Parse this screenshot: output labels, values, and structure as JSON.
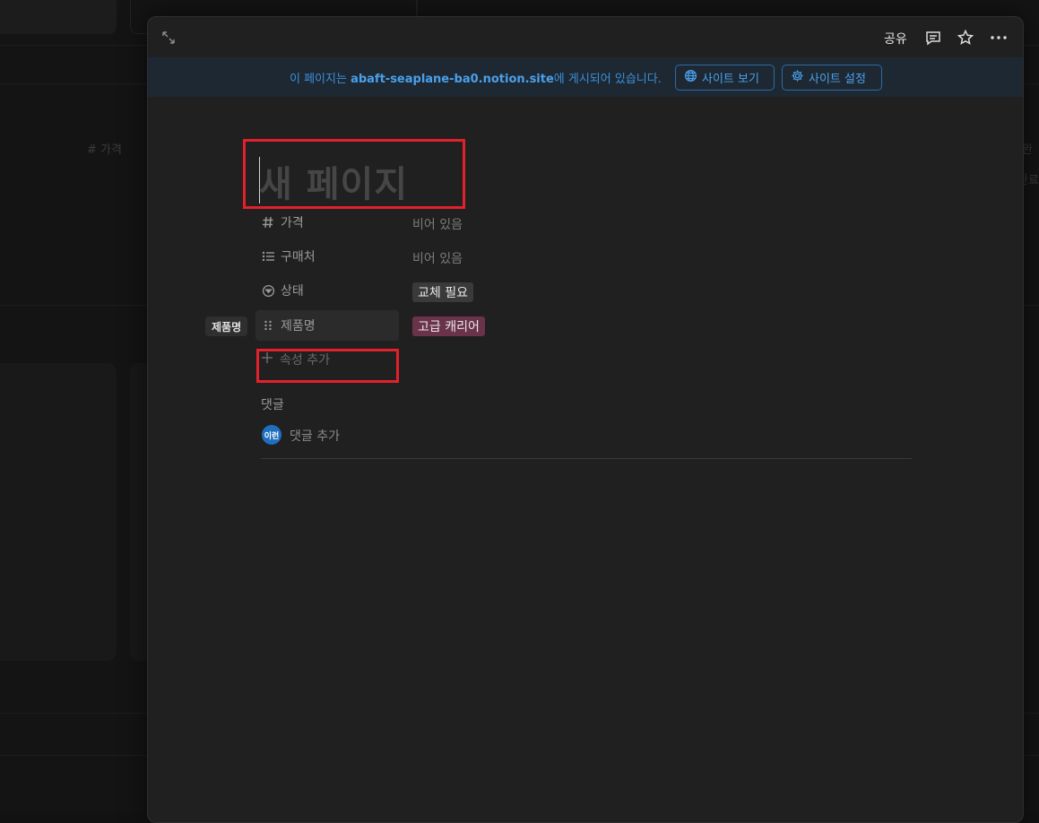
{
  "background": {
    "column_label": "# 가격",
    "right_text_1": "완",
    "right_text_2": "완료"
  },
  "topbar": {
    "expand_icon": "expand-diagonal-icon",
    "share_label": "공유",
    "comment_icon": "comment-icon",
    "star_icon": "star-icon",
    "more_icon": "more-horizontal-icon"
  },
  "banner": {
    "text_prefix": "이 페이지는 ",
    "site_domain": "abaft-seaplane-ba0.notion.site",
    "text_suffix": "에 게시되어 있습니다.",
    "view_site_label": "사이트 보기",
    "site_settings_label": "사이트 설정",
    "accent_color": "#3b8fd9"
  },
  "page": {
    "title_placeholder": "새 페이지"
  },
  "properties": [
    {
      "icon": "hash-icon",
      "name": "가격",
      "value": "비어 있음",
      "type": "empty"
    },
    {
      "icon": "list-icon",
      "name": "구매처",
      "value": "비어 있음",
      "type": "empty"
    },
    {
      "icon": "status-icon",
      "name": "상태",
      "value": "교체 필요",
      "type": "tag",
      "color": "#3a3a3a"
    },
    {
      "icon": "drag-handle-icon",
      "name": "제품명",
      "value": "고급 캐리어",
      "type": "tag",
      "color": "#6a3349"
    }
  ],
  "tooltip": "제품명",
  "add_property_label": "속성 추가",
  "comments": {
    "label": "댓글",
    "avatar_initials": "이런",
    "add_comment_placeholder": "댓글 추가"
  },
  "highlight_color": "#e3202b"
}
